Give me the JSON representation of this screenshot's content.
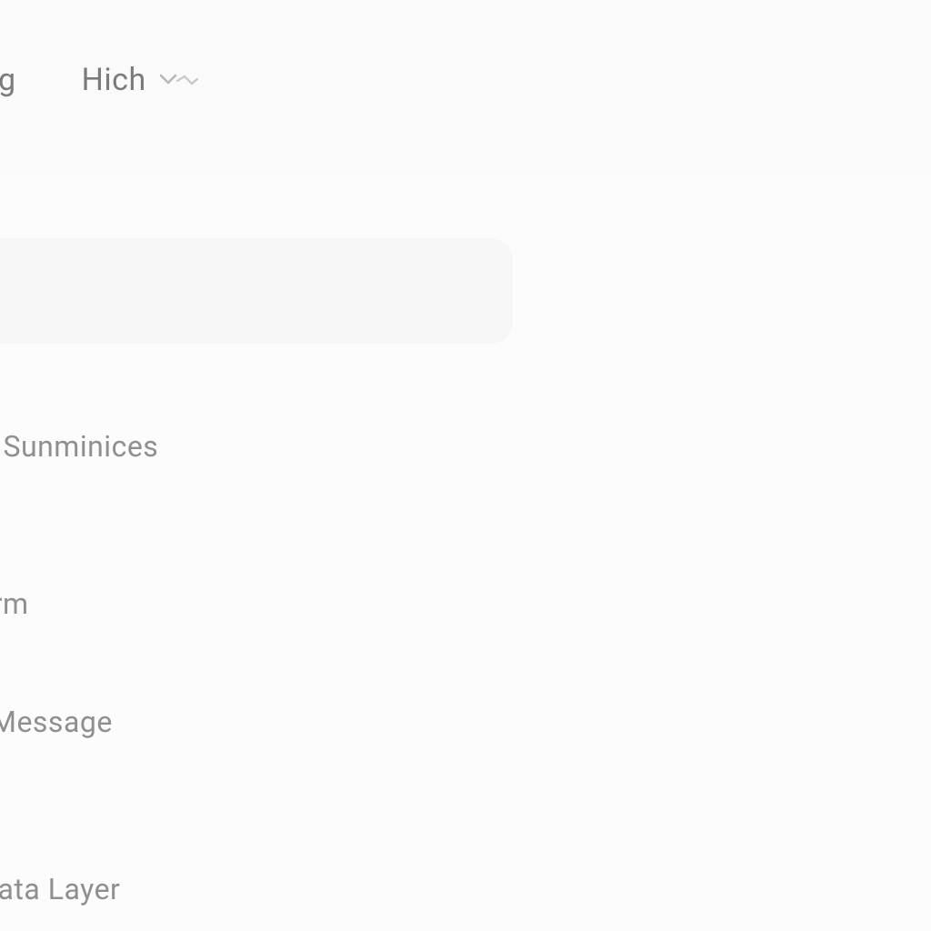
{
  "nav": {
    "items": [
      {
        "label": "ing"
      },
      {
        "label": "Hich"
      }
    ]
  },
  "list": {
    "items": [
      {
        "label": "s Sunminices"
      },
      {
        "label": "irrm"
      },
      {
        "label": "Message"
      },
      {
        "label": "Data Layer"
      }
    ]
  }
}
